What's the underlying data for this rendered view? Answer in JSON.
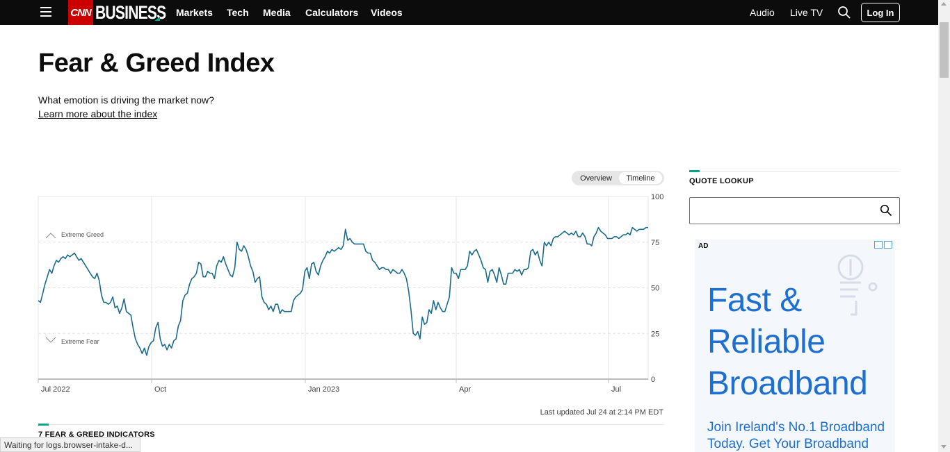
{
  "header": {
    "logo_cnn": "CNN",
    "logo_business": "BUSINESS",
    "nav": [
      "Markets",
      "Tech",
      "Media",
      "Calculators",
      "Videos"
    ],
    "right_nav": [
      "Audio",
      "Live TV"
    ],
    "login_label": "Log In"
  },
  "page": {
    "title": "Fear & Greed Index",
    "subtitle": "What emotion is driving the market now?",
    "learn_link": "Learn more about the index"
  },
  "toggle": {
    "overview": "Overview",
    "timeline": "Timeline",
    "active": "timeline"
  },
  "chart_data": {
    "type": "line",
    "title": "",
    "xlabel": "",
    "ylabel": "",
    "x_tick_labels": [
      "Jul 2022",
      "Oct",
      "Jan 2023",
      "Apr",
      "Jul"
    ],
    "y_tick_labels": [
      "100",
      "75",
      "50",
      "25",
      "0"
    ],
    "ylim": [
      0,
      100
    ],
    "zone_labels": [
      "Extreme Greed",
      "Extreme Fear"
    ],
    "series_color": "#1a6b8a",
    "series": [
      {
        "values": [
          43,
          42,
          47,
          52,
          56,
          60,
          58,
          62,
          65,
          64,
          66,
          67,
          66,
          68,
          67,
          68,
          69,
          67,
          65,
          66,
          64,
          62,
          60,
          58,
          56,
          55,
          58,
          54,
          46,
          42,
          42,
          41,
          42,
          45,
          39,
          40,
          36,
          39,
          44,
          37,
          36,
          35,
          28,
          22,
          19,
          17,
          14,
          17,
          13,
          18,
          20,
          21,
          28,
          31,
          22,
          18,
          19,
          16,
          19,
          17,
          21,
          22,
          29,
          32,
          43,
          46,
          47,
          52,
          55,
          56,
          58,
          64,
          63,
          56,
          56,
          59,
          58,
          58,
          55,
          62,
          65,
          64,
          67,
          63,
          60,
          57,
          56,
          61,
          75,
          71,
          70,
          73,
          71,
          67,
          62,
          59,
          53,
          55,
          56,
          45,
          42,
          41,
          38,
          40,
          37,
          41,
          41,
          36,
          38,
          37,
          37,
          37,
          37,
          43,
          45,
          46,
          47,
          49,
          59,
          61,
          55,
          63,
          64,
          59,
          57,
          62,
          65,
          67,
          70,
          69,
          71,
          70,
          71,
          72,
          71,
          73,
          82,
          76,
          77,
          75,
          74,
          74,
          74,
          74,
          74,
          70,
          69,
          69,
          65,
          64,
          62,
          60,
          61,
          61,
          60,
          60,
          58,
          60,
          59,
          58,
          58,
          60,
          58,
          55,
          48,
          38,
          25,
          24,
          26,
          22,
          34,
          30,
          31,
          38,
          36,
          43,
          38,
          42,
          39,
          37,
          37,
          41,
          45,
          61,
          58,
          58,
          55,
          60,
          60,
          60,
          62,
          70,
          68,
          70,
          71,
          68,
          65,
          61,
          60,
          53,
          59,
          60,
          57,
          53,
          61,
          57,
          52,
          52,
          58,
          58,
          58,
          60,
          59,
          60,
          57,
          60,
          60,
          61,
          70,
          71,
          68,
          70,
          65,
          62,
          75,
          73,
          75,
          73,
          77,
          78,
          78,
          79,
          80,
          81,
          80,
          79,
          80,
          79,
          81,
          78,
          78,
          80,
          78,
          74,
          74,
          73,
          78,
          80,
          83,
          81,
          80,
          79,
          77,
          77,
          77,
          78,
          78,
          77,
          78,
          79,
          79,
          80,
          79,
          83,
          82,
          81,
          82,
          82,
          82,
          83,
          83
        ]
      }
    ]
  },
  "updated_text": "Last updated Jul 24 at 2:14 PM EDT",
  "indicators_title": "7 FEAR & GREED INDICATORS",
  "quote_lookup": {
    "title": "QUOTE LOOKUP",
    "value": "",
    "placeholder": ""
  },
  "ad": {
    "label": "AD",
    "headline_lines": [
      "Fast &",
      "Reliable",
      "Broadband"
    ],
    "sub_lines": [
      "Join Ireland's No.1 Broadband",
      "Today. Get Your Broadband"
    ]
  },
  "status_bar": "Waiting for logs.browser-intake-d..."
}
